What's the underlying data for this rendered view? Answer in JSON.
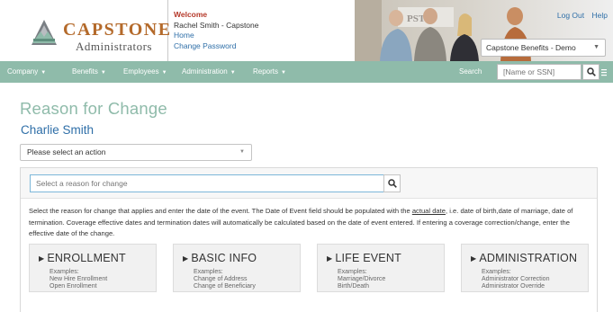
{
  "logo": {
    "name": "CAPSTONE",
    "sub": "Administrators"
  },
  "welcome": {
    "title": "Welcome",
    "user": "Rachel Smith - Capstone",
    "home": "Home",
    "change_password": "Change Password"
  },
  "top_links": {
    "log_out": "Log Out",
    "help": "Help"
  },
  "company_select": {
    "value": "Capstone Benefits - Demo"
  },
  "nav": {
    "items": [
      {
        "label": "Company"
      },
      {
        "label": "Benefits"
      },
      {
        "label": "Employees"
      },
      {
        "label": "Administration"
      },
      {
        "label": "Reports"
      }
    ],
    "search_label": "Search",
    "search_placeholder": "[Name or SSN]"
  },
  "page": {
    "title": "Reason for Change",
    "person_name": "Charlie  Smith",
    "action_select": "Please select an action",
    "reason_placeholder": "Select a reason for change",
    "instructions_part1": "Select the reason for change that applies and enter the date of the event. The Date of Event field should be populated with the ",
    "instructions_link": "actual date",
    "instructions_part2": ", i.e. date of birth,date of marriage, date of termination. Coverage effective dates and termination dates will automatically be calculated based on the date of event entered. If entering a coverage correction/change, enter the effective date of the change."
  },
  "cards": [
    {
      "title": "ENROLLMENT",
      "examples_label": "Examples:",
      "examples": [
        "New Hire Enrollment",
        "Open Enrollment"
      ]
    },
    {
      "title": "BASIC INFO",
      "examples_label": "Examples:",
      "examples": [
        "Change of Address",
        "Change of Beneficiary"
      ]
    },
    {
      "title": "LIFE EVENT",
      "examples_label": "Examples:",
      "examples": [
        "Marriage/Divorce",
        "Birth/Death"
      ]
    },
    {
      "title": "ADMINISTRATION",
      "examples_label": "Examples:",
      "examples": [
        "Administrator Correction",
        "Administrator Override"
      ]
    }
  ],
  "colors": {
    "nav_bg": "#8fbbaa",
    "brand": "#b46a2b",
    "link": "#2f6fa8",
    "welcome": "#b5392a"
  },
  "icons": {
    "search": "magnifier-icon",
    "dropdown": "caret-down-icon",
    "card": "triangle-right-icon"
  }
}
